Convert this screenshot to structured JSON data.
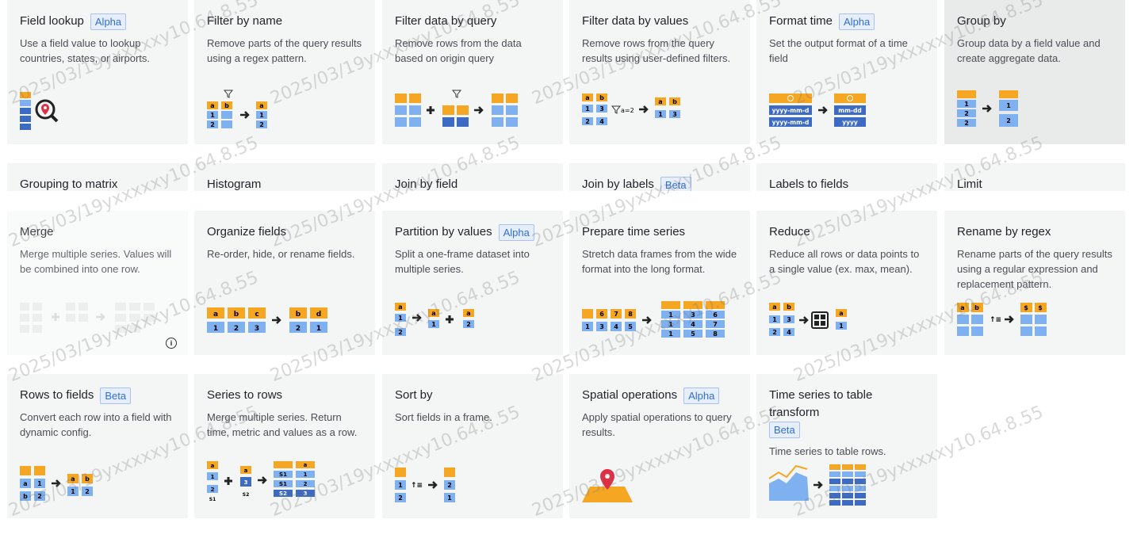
{
  "cards": [
    {
      "id": "field-lookup",
      "title": "Field lookup",
      "badge": "Alpha",
      "desc": "Use a field value to lookup countries, states, or airports."
    },
    {
      "id": "filter-by-name",
      "title": "Filter by name",
      "badge": "",
      "desc": "Remove parts of the query results using a regex pattern."
    },
    {
      "id": "filter-data-by-query",
      "title": "Filter data by query",
      "badge": "",
      "desc": "Remove rows from the data based on origin query"
    },
    {
      "id": "filter-data-by-values",
      "title": "Filter data by values",
      "badge": "",
      "desc": "Remove rows from the query results using user-defined filters."
    },
    {
      "id": "format-time",
      "title": "Format time",
      "badge": "Alpha",
      "desc": "Set the output format of a time field"
    },
    {
      "id": "group-by",
      "title": "Group by",
      "badge": "",
      "desc": "Group data by a field value and create aggregate data."
    },
    {
      "id": "grouping-to-matrix",
      "title": "Grouping to matrix",
      "badge": "",
      "desc": ""
    },
    {
      "id": "histogram",
      "title": "Histogram",
      "badge": "",
      "desc": ""
    },
    {
      "id": "join-by-field",
      "title": "Join by field",
      "badge": "",
      "desc": ""
    },
    {
      "id": "join-by-labels",
      "title": "Join by labels",
      "badge": "Beta",
      "desc": ""
    },
    {
      "id": "labels-to-fields",
      "title": "Labels to fields",
      "badge": "",
      "desc": ""
    },
    {
      "id": "limit",
      "title": "Limit",
      "badge": "",
      "desc": ""
    },
    {
      "id": "merge",
      "title": "Merge",
      "badge": "",
      "desc": "Merge multiple series. Values will be combined into one row."
    },
    {
      "id": "organize-fields",
      "title": "Organize fields",
      "badge": "",
      "desc": "Re-order, hide, or rename fields."
    },
    {
      "id": "partition-by-values",
      "title": "Partition by values",
      "badge": "Alpha",
      "desc": "Split a one-frame dataset into multiple series."
    },
    {
      "id": "prepare-time-series",
      "title": "Prepare time series",
      "badge": "",
      "desc": "Stretch data frames from the wide format into the long format."
    },
    {
      "id": "reduce",
      "title": "Reduce",
      "badge": "",
      "desc": "Reduce all rows or data points to a single value (ex. max, mean)."
    },
    {
      "id": "rename-by-regex",
      "title": "Rename by regex",
      "badge": "",
      "desc": "Rename parts of the query results using a regular expression and replacement pattern."
    },
    {
      "id": "rows-to-fields",
      "title": "Rows to fields",
      "badge": "Beta",
      "desc": "Convert each row into a field with dynamic config."
    },
    {
      "id": "series-to-rows",
      "title": "Series to rows",
      "badge": "",
      "desc": "Merge multiple series. Return time, metric and values as a row."
    },
    {
      "id": "sort-by",
      "title": "Sort by",
      "badge": "",
      "desc": "Sort fields in a frame."
    },
    {
      "id": "spatial-operations",
      "title": "Spatial operations",
      "badge": "Alpha",
      "desc": "Apply spatial operations to query results."
    },
    {
      "id": "time-series-to-table",
      "title": "Time series to table transform",
      "badge": "Beta",
      "desc": "Time series to table rows."
    }
  ],
  "illus": {
    "filter_by_name": {
      "h": [
        "a",
        "b"
      ],
      "rows": [
        "1",
        "2"
      ],
      "out_h": "a",
      "out": [
        "1",
        "2"
      ]
    },
    "filter_by_values": {
      "h": [
        "a",
        "b"
      ],
      "r1": [
        "1",
        "3"
      ],
      "r2": [
        "2",
        "4"
      ],
      "cond": "a=2",
      "out_h": [
        "a",
        "b"
      ],
      "out": [
        "1",
        "3"
      ]
    },
    "format_time": {
      "in": [
        "yyyy-mm-d",
        "yyyy-mm-d"
      ],
      "out": [
        "mm-dd",
        "yyyy"
      ]
    },
    "group_by": {
      "in": [
        "1",
        "2",
        "2"
      ],
      "out": [
        "1",
        "2"
      ]
    },
    "organize": {
      "in_h": [
        "a",
        "b",
        "c"
      ],
      "in": [
        "1",
        "2",
        "3"
      ],
      "out_h": [
        "b",
        "d"
      ],
      "out": [
        "2",
        "1"
      ]
    },
    "partition": {
      "h": "a",
      "in": [
        "1",
        "2"
      ],
      "o1h": "a",
      "o1": "1",
      "o2h": "a",
      "o2": "2"
    },
    "prepare": {
      "h": [
        "6",
        "7",
        "8"
      ],
      "r": [
        "1",
        "3",
        "4",
        "5"
      ],
      "o1": [
        "1",
        "3",
        "6"
      ],
      "o2": [
        "1",
        "4",
        "7"
      ],
      "o3": [
        "1",
        "5",
        "8"
      ]
    },
    "reduce": {
      "h": [
        "a",
        "b"
      ],
      "r1": [
        "1",
        "3"
      ],
      "r2": [
        "2",
        "4"
      ],
      "out_h": "a",
      "out": "1"
    },
    "rename": {
      "h": [
        "a",
        "b"
      ],
      "out_h": [
        "$",
        "$"
      ]
    },
    "rows_to_fields": {
      "r1": [
        "a",
        "1"
      ],
      "r2": [
        "b",
        "2"
      ],
      "out_h": [
        "a",
        "b"
      ],
      "out": [
        "1",
        "2"
      ]
    },
    "series_to_rows": {
      "s1h": "a",
      "s1": [
        "1",
        "2"
      ],
      "s1n": "S1",
      "s2h": "a",
      "s2": "3",
      "s2n": "S2",
      "out_h": "a",
      "out": [
        [
          "S1",
          "1"
        ],
        [
          "S1",
          "2"
        ],
        [
          "S2",
          "3"
        ]
      ]
    },
    "sort_by": {
      "in": [
        "1",
        "2"
      ],
      "out": [
        "2",
        "1"
      ]
    }
  },
  "watermark": "2025/03/19yxxxxxy10.64.8.55",
  "colors": {
    "card": "#f4f5f5",
    "accent": "#f5a623",
    "blue": "#7fb0f0",
    "dark_blue": "#3d6bc4",
    "badge_text": "#2f6fd3"
  }
}
